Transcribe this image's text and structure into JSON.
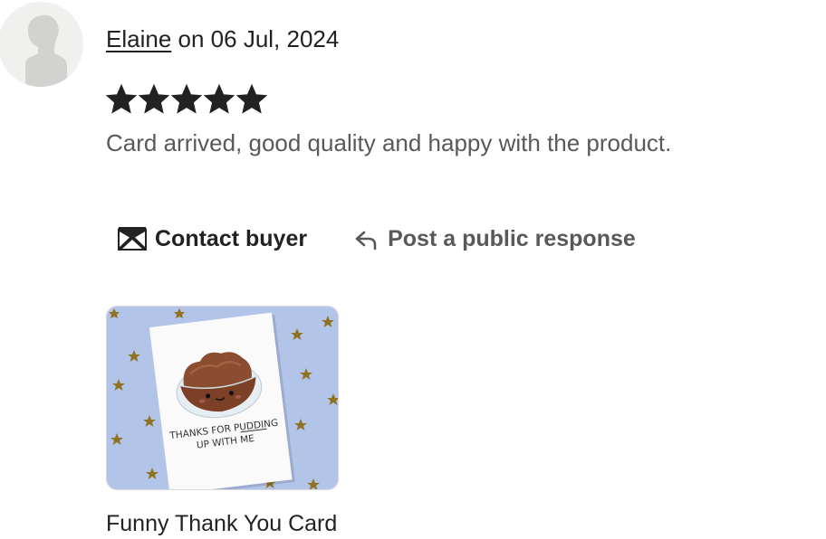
{
  "reviewer": {
    "name": "Elaine",
    "date_prefix": "on",
    "date": "06 Jul, 2024",
    "avatar_icon": "default-person-silhouette"
  },
  "review": {
    "rating": 5,
    "max_rating": 5,
    "star_color": "#222222",
    "text": "Card arrived, good quality and happy with the product."
  },
  "actions": {
    "contact_label": "Contact buyer",
    "contact_icon": "envelope-icon",
    "public_label": "Post a public response",
    "public_icon": "reply-arrow-icon"
  },
  "product": {
    "image_card_text_line1": "THANKS FOR PUDDING",
    "image_card_text_line2": "UP WITH ME",
    "image_background_color": "#b3c4e9",
    "title": "Funny Thank You Card"
  }
}
